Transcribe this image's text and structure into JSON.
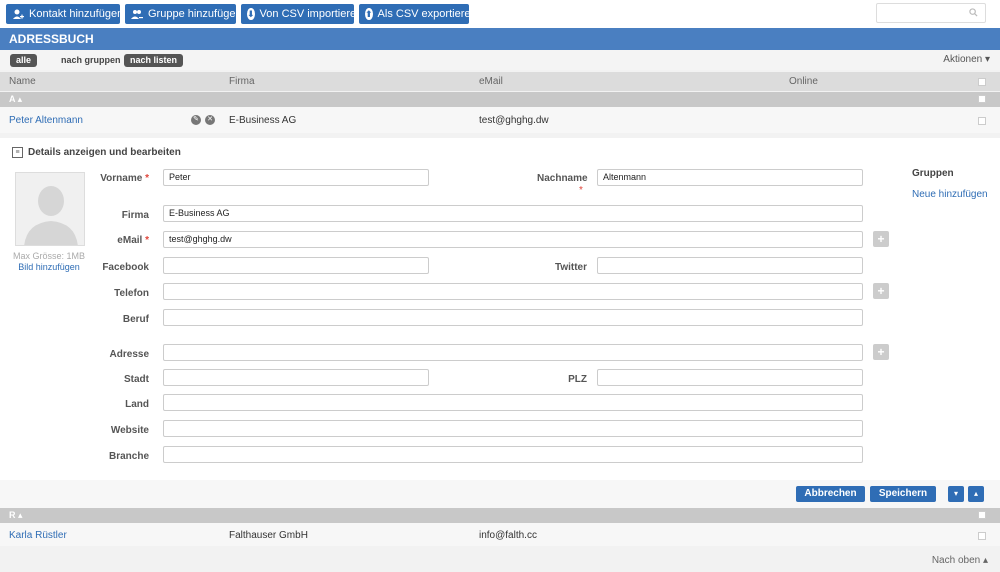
{
  "toolbar": {
    "add_contact": "Kontakt hinzufügen",
    "add_group": "Gruppe hinzufügen",
    "import_csv": "Von CSV importieren",
    "export_csv": "Als CSV exportieren",
    "search_placeholder": ""
  },
  "title": "ADRESSBUCH",
  "filter": {
    "all": "alle",
    "by_groups": "nach gruppen",
    "by_lists": "nach listen",
    "actions": "Aktionen ▾"
  },
  "columns": {
    "name": "Name",
    "company": "Firma",
    "email": "eMail",
    "online": "Online"
  },
  "groups": [
    {
      "label": "A ▴"
    },
    {
      "label": "R ▴"
    }
  ],
  "contacts": [
    {
      "name": "Peter Altenmann",
      "company": "E-Business AG",
      "email": "test@ghghg.dw"
    },
    {
      "name": "Karla Rüstler",
      "company": "Falthauser GmbH",
      "email": "info@falth.cc"
    }
  ],
  "detail": {
    "title": "Details anzeigen und bearbeiten",
    "max_size": "Max Grösse: 1MB",
    "add_image": "Bild hinzufügen",
    "labels": {
      "vorname": "Vorname",
      "nachname": "Nachname",
      "firma": "Firma",
      "email": "eMail",
      "facebook": "Facebook",
      "twitter": "Twitter",
      "telefon": "Telefon",
      "beruf": "Beruf",
      "adresse": "Adresse",
      "stadt": "Stadt",
      "plz": "PLZ",
      "land": "Land",
      "website": "Website",
      "branche": "Branche"
    },
    "required_mark": "*",
    "values": {
      "vorname": "Peter",
      "nachname": "Altenmann",
      "firma": "E-Business AG",
      "email": "test@ghghg.dw",
      "facebook": "",
      "twitter": "",
      "telefon": "",
      "beruf": "",
      "adresse": "",
      "stadt": "",
      "plz": "",
      "land": "",
      "website": "",
      "branche": ""
    },
    "groups_heading": "Gruppen",
    "add_new": "Neue hinzufügen",
    "plus": "+"
  },
  "actions": {
    "cancel": "Abbrechen",
    "save": "Speichern",
    "down": "▾",
    "up": "▴"
  },
  "footer": {
    "to_top": "Nach oben ▴"
  },
  "colors": {
    "primary": "#2f6db5",
    "title_bar": "#4a7fc1",
    "required": "#e0463b"
  }
}
